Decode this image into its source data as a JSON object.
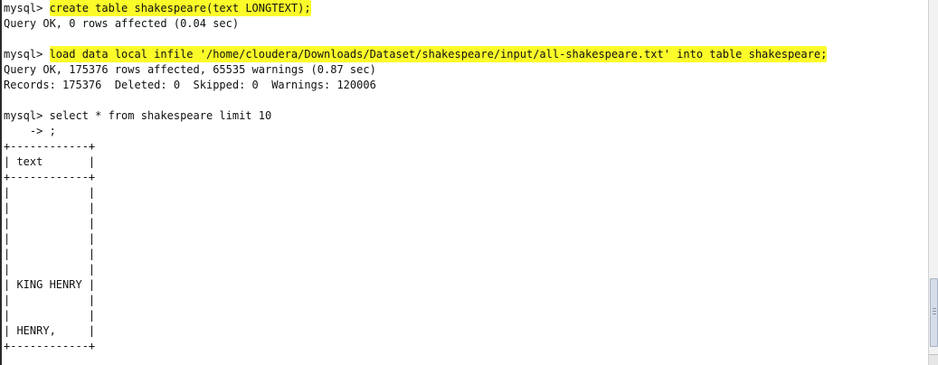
{
  "terminal": {
    "lines": [
      {
        "prefix": "mysql> ",
        "highlight": "create table shakespeare(text LONGTEXT);",
        "rest": ""
      },
      {
        "prefix": "Query OK, 0 rows affected (0.04 sec)",
        "highlight": "",
        "rest": ""
      },
      {
        "prefix": "",
        "highlight": "",
        "rest": ""
      },
      {
        "prefix": "mysql> ",
        "highlight": "load data local infile '/home/cloudera/Downloads/Dataset/shakespeare/input/all-shakespeare.txt' into table shakespeare;",
        "rest": ""
      },
      {
        "prefix": "Query OK, 175376 rows affected, 65535 warnings (0.87 sec)",
        "highlight": "",
        "rest": ""
      },
      {
        "prefix": "Records: 175376  Deleted: 0  Skipped: 0  Warnings: 120006",
        "highlight": "",
        "rest": ""
      },
      {
        "prefix": "",
        "highlight": "",
        "rest": ""
      },
      {
        "prefix": "mysql> select * from shakespeare limit 10",
        "highlight": "",
        "rest": ""
      },
      {
        "prefix": "    -> ;",
        "highlight": "",
        "rest": ""
      },
      {
        "prefix": "+------------+",
        "highlight": "",
        "rest": ""
      },
      {
        "prefix": "| text       |",
        "highlight": "",
        "rest": ""
      },
      {
        "prefix": "+------------+",
        "highlight": "",
        "rest": ""
      },
      {
        "prefix": "|            |",
        "highlight": "",
        "rest": ""
      },
      {
        "prefix": "|            |",
        "highlight": "",
        "rest": ""
      },
      {
        "prefix": "|            |",
        "highlight": "",
        "rest": ""
      },
      {
        "prefix": "|            |",
        "highlight": "",
        "rest": ""
      },
      {
        "prefix": "|            |",
        "highlight": "",
        "rest": ""
      },
      {
        "prefix": "|            |",
        "highlight": "",
        "rest": ""
      },
      {
        "prefix": "| KING HENRY |",
        "highlight": "",
        "rest": ""
      },
      {
        "prefix": "|            |",
        "highlight": "",
        "rest": ""
      },
      {
        "prefix": "|            |",
        "highlight": "",
        "rest": ""
      },
      {
        "prefix": "| HENRY,     |",
        "highlight": "",
        "rest": ""
      },
      {
        "prefix": "+------------+",
        "highlight": "",
        "rest": ""
      }
    ]
  },
  "colors": {
    "highlight": "#fbfb2a",
    "text": "#111111",
    "background": "#ffffff"
  },
  "scrollbar": {
    "position_fraction": 0.85
  }
}
